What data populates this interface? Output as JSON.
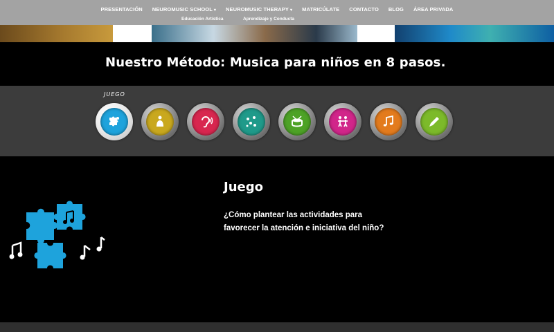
{
  "nav": {
    "items": [
      {
        "label": "PRESENTACIÓN",
        "has_caret": false
      },
      {
        "label": "NEUROMUSIC SCHOOL",
        "has_caret": true
      },
      {
        "label": "NEUROMUSIC THERAPY",
        "has_caret": true
      },
      {
        "label": "MATRICÚLATE",
        "has_caret": false
      },
      {
        "label": "CONTACTO",
        "has_caret": false
      },
      {
        "label": "BLOG",
        "has_caret": false
      },
      {
        "label": "ÁREA PRIVADA",
        "has_caret": false
      }
    ],
    "submenu": [
      "Educación Artística",
      "Aprendizaje y Conducta"
    ],
    "background_color": "#a3a3a3"
  },
  "page": {
    "title": "Nuestro Método: Musica para niños en 8 pasos."
  },
  "steps": {
    "caption": "JUEGO",
    "items": [
      {
        "name": "juego",
        "color": "#1ea3dc",
        "icon": "puzzle-icon",
        "active": true
      },
      {
        "name": "step-2",
        "color": "#c9a81e",
        "icon": "bell-icon",
        "active": false
      },
      {
        "name": "step-3",
        "color": "#d8264f",
        "icon": "ear-icon",
        "active": false
      },
      {
        "name": "step-4",
        "color": "#1f9a8a",
        "icon": "notes-scatter-icon",
        "active": false
      },
      {
        "name": "step-5",
        "color": "#4da226",
        "icon": "drum-icon",
        "active": false
      },
      {
        "name": "step-6",
        "color": "#d1268a",
        "icon": "dancing-kids-icon",
        "active": false
      },
      {
        "name": "step-7",
        "color": "#e37b1d",
        "icon": "music-notes-icon",
        "active": false
      },
      {
        "name": "step-8",
        "color": "#7cba2a",
        "icon": "pencil-icon",
        "active": false
      }
    ]
  },
  "content": {
    "title": "Juego",
    "question": "¿Cómo plantear las actividades  para favorecer la atención e iniciativa del niño?"
  },
  "colors": {
    "accent": "#1ea3dc",
    "band": "#3c3c3c"
  }
}
